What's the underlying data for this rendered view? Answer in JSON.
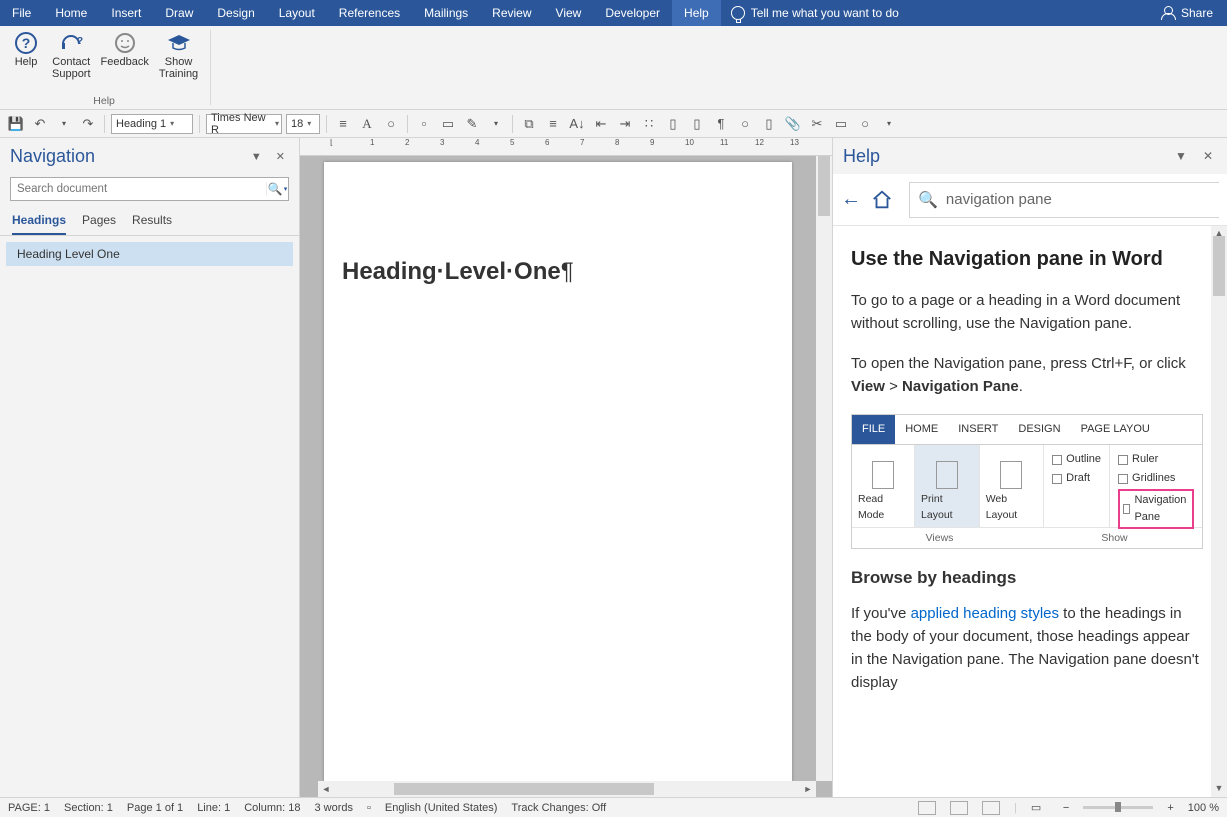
{
  "ribbon": {
    "tabs": [
      "File",
      "Home",
      "Insert",
      "Draw",
      "Design",
      "Layout",
      "References",
      "Mailings",
      "Review",
      "View",
      "Developer",
      "Help"
    ],
    "active_tab": "Help",
    "tellme_placeholder": "Tell me what you want to do",
    "share_label": "Share"
  },
  "help_ribbon": {
    "group_label": "Help",
    "buttons": {
      "help": "Help",
      "contact_support_l1": "Contact",
      "contact_support_l2": "Support",
      "feedback": "Feedback",
      "show_training_l1": "Show",
      "show_training_l2": "Training"
    }
  },
  "qat": {
    "style_value": "Heading 1",
    "font_value": "Times New R",
    "size_value": "18"
  },
  "navigation": {
    "title": "Navigation",
    "search_placeholder": "Search document",
    "tabs": [
      "Headings",
      "Pages",
      "Results"
    ],
    "active_tab": "Headings",
    "items": [
      "Heading Level One"
    ]
  },
  "document": {
    "heading_text": "Heading·Level·One",
    "paragraph_mark": "¶"
  },
  "help_pane": {
    "title": "Help",
    "search_query": "navigation pane",
    "article": {
      "h2": "Use the Navigation pane in Word",
      "p1": "To go to a page or a heading in a Word document without scrolling, use the Navigation pane.",
      "p2a": "To open the Navigation pane, press Ctrl+F, or click ",
      "p2b_view": "View",
      "p2c_gt": " > ",
      "p2d_navpane": "Navigation Pane",
      "p2e_dot": ".",
      "illus_tabs": [
        "FILE",
        "HOME",
        "INSERT",
        "DESIGN",
        "PAGE LAYOU"
      ],
      "illus_views": {
        "read": "Read Mode",
        "print": "Print Layout",
        "web": "Web Layout",
        "outline": "Outline",
        "draft": "Draft"
      },
      "illus_show": {
        "ruler": "Ruler",
        "gridlines": "Gridlines",
        "navpane": "Navigation Pane"
      },
      "illus_groups": {
        "views": "Views",
        "show": "Show"
      },
      "sub1": "Browse by headings",
      "p3a": "If you've ",
      "p3_link": "applied heading styles",
      "p3b": " to the headings in the body of your document, those headings appear in the Navigation pane. The Navigation pane doesn't display"
    }
  },
  "statusbar": {
    "page": "PAGE:  1",
    "section": "Section:  1",
    "page_of": "Page 1 of 1",
    "line": "Line:  1",
    "column": "Column: 18",
    "words": "3 words",
    "language": "English (United States)",
    "track": "Track Changes: Off",
    "zoom": "100 %"
  }
}
